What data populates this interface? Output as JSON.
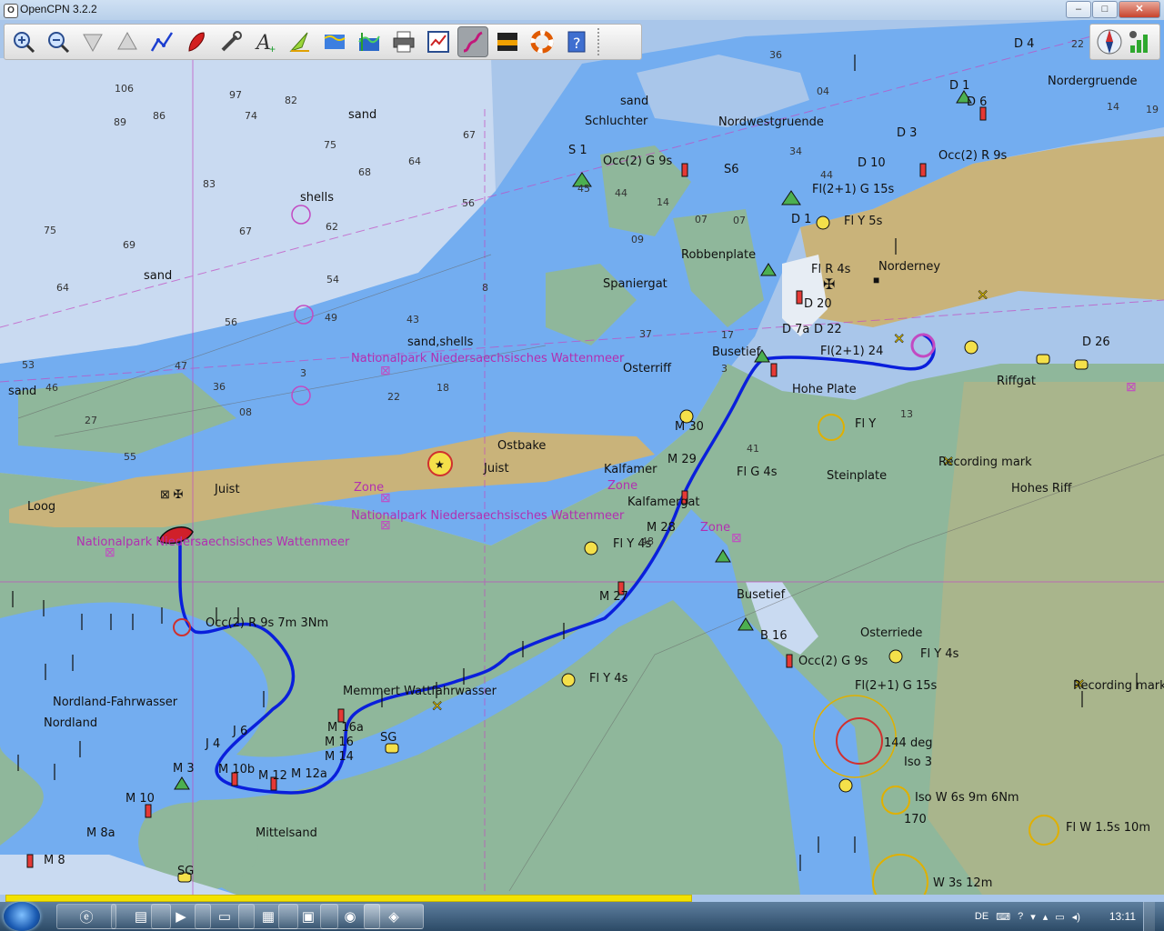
{
  "window": {
    "title": "OpenCPN 3.2.2",
    "app_icon": "O",
    "minimize": "–",
    "maximize": "□",
    "close": "✕"
  },
  "toolbar": {
    "tools": [
      {
        "name": "zoom-in-icon"
      },
      {
        "name": "zoom-out-icon"
      },
      {
        "name": "scale-in-icon"
      },
      {
        "name": "scale-out-icon"
      },
      {
        "name": "route-icon"
      },
      {
        "name": "auto-follow-icon"
      },
      {
        "name": "settings-icon"
      },
      {
        "name": "text-icon"
      },
      {
        "name": "current-icon"
      },
      {
        "name": "tide-icon"
      },
      {
        "name": "tide-current-icon"
      },
      {
        "name": "print-icon"
      },
      {
        "name": "route-manager-icon"
      },
      {
        "name": "track-icon"
      },
      {
        "name": "color-scheme-icon"
      },
      {
        "name": "mob-icon"
      },
      {
        "name": "help-icon"
      }
    ],
    "active_index": 13
  },
  "right_toolbar": {
    "compass": "compass-icon",
    "gps": "gps-status-icon"
  },
  "chart": {
    "place_labels": [
      {
        "text": "Nordergruende"
      },
      {
        "text": "Schluchter"
      },
      {
        "text": "sand"
      },
      {
        "text": "Nordwestgruende"
      },
      {
        "text": "shells"
      },
      {
        "text": "sand"
      },
      {
        "text": "sand,shells"
      },
      {
        "text": "Robbenplate"
      },
      {
        "text": "Norderney"
      },
      {
        "text": "Spaniergat"
      },
      {
        "text": "Osterriff"
      },
      {
        "text": "Busetief"
      },
      {
        "text": "Hohe Plate"
      },
      {
        "text": "Riffgat"
      },
      {
        "text": "Steinplate"
      },
      {
        "text": "Ostbake"
      },
      {
        "text": "Juist"
      },
      {
        "text": "Juist"
      },
      {
        "text": "Loog"
      },
      {
        "text": "Kalfamer"
      },
      {
        "text": "Kalfamergat"
      },
      {
        "text": "Hohes Riff"
      },
      {
        "text": "Busetief"
      },
      {
        "text": "Osterriede"
      },
      {
        "text": "Memmert Wattfahrwasser"
      },
      {
        "text": "Nordland-Fahrwasser"
      },
      {
        "text": "Nordland"
      },
      {
        "text": "Mittelsand"
      },
      {
        "text": "sand"
      },
      {
        "text": "sand"
      }
    ],
    "light_labels": [
      {
        "text": "Occ(2) R 9s"
      },
      {
        "text": "Fl(2+1) G 15s"
      },
      {
        "text": "Fl Y 5s"
      },
      {
        "text": "Fl R 4s"
      },
      {
        "text": "Fl(2+1) 24"
      },
      {
        "text": "Fl Y"
      },
      {
        "text": "Fl G 4s"
      },
      {
        "text": "Fl Y 4s"
      },
      {
        "text": "Fl Y 4s"
      },
      {
        "text": "Fl Y 4s"
      },
      {
        "text": "Occ(2) G 9s"
      },
      {
        "text": "Fl(2+1) G 15s"
      },
      {
        "text": "Iso 3"
      },
      {
        "text": "Iso W 6s 9m 6Nm"
      },
      {
        "text": "Fl W 1.5s 10m"
      },
      {
        "text": "W 3s 12m"
      },
      {
        "text": "Occ(2) R 9s 7m 3Nm"
      },
      {
        "text": "Recording mark"
      },
      {
        "text": "Recording mark"
      },
      {
        "text": "144 deg"
      },
      {
        "text": "170"
      },
      {
        "text": "Occ(2) G 9s"
      }
    ],
    "buoy_labels": [
      {
        "text": "D 4"
      },
      {
        "text": "D 1"
      },
      {
        "text": "D 6"
      },
      {
        "text": "D 3"
      },
      {
        "text": "D 10"
      },
      {
        "text": "D 1"
      },
      {
        "text": "D 20"
      },
      {
        "text": "D 7a"
      },
      {
        "text": "D 22"
      },
      {
        "text": "D 26"
      },
      {
        "text": "S 1"
      },
      {
        "text": "S6"
      },
      {
        "text": "M 30"
      },
      {
        "text": "M 29"
      },
      {
        "text": "M 28"
      },
      {
        "text": "M 27"
      },
      {
        "text": "M 16a"
      },
      {
        "text": "M 16"
      },
      {
        "text": "M 14"
      },
      {
        "text": "M 12a"
      },
      {
        "text": "M 12"
      },
      {
        "text": "M 10b"
      },
      {
        "text": "M 3"
      },
      {
        "text": "M 10"
      },
      {
        "text": "M 8a"
      },
      {
        "text": "M 8"
      },
      {
        "text": "J 4"
      },
      {
        "text": "J 6"
      },
      {
        "text": "B 16"
      },
      {
        "text": "SG"
      },
      {
        "text": "SG"
      }
    ],
    "magenta_labels": [
      {
        "text": "Nationalpark Niedersaechsisches Wattenmeer"
      },
      {
        "text": "Nationalpark Niedersaechsisches Wattenmeer"
      },
      {
        "text": "Nationalpark Niedersaechsisches Wattenmeer"
      },
      {
        "text": "Zone"
      },
      {
        "text": "Zone"
      },
      {
        "text": "Zone"
      }
    ],
    "soundings": [
      "106",
      "97",
      "82",
      "89",
      "86",
      "74",
      "75",
      "67",
      "64",
      "68",
      "83",
      "56",
      "62",
      "67",
      "75",
      "69",
      "54",
      "49",
      "64",
      "56",
      "53",
      "46",
      "43",
      "27",
      "47",
      "36",
      "55",
      "8",
      "18",
      "22",
      "3",
      "08",
      "45",
      "44",
      "14",
      "09",
      "07",
      "07",
      "04",
      "44",
      "37",
      "17",
      "3",
      "36",
      "34",
      "22",
      "14",
      "19",
      "13",
      "41",
      "48"
    ]
  },
  "status_bar": {
    "progress": 0.59
  },
  "taskbar": {
    "buttons": [
      "ie-icon",
      "explorer-icon",
      "media-player-icon",
      "window-icon",
      "notepad-icon",
      "pdf-icon",
      "chrome-icon",
      "opencpn-icon"
    ],
    "language": "DE",
    "time": "13:11"
  },
  "colors": {
    "deep_water": "#a9c6ea",
    "mid_water": "#73adf0",
    "channel": "#c9daf1",
    "land": "#c9b37a",
    "intertidal": "#8fb79b",
    "route": "#0a1fdc",
    "magenta": "#c24ac2"
  }
}
